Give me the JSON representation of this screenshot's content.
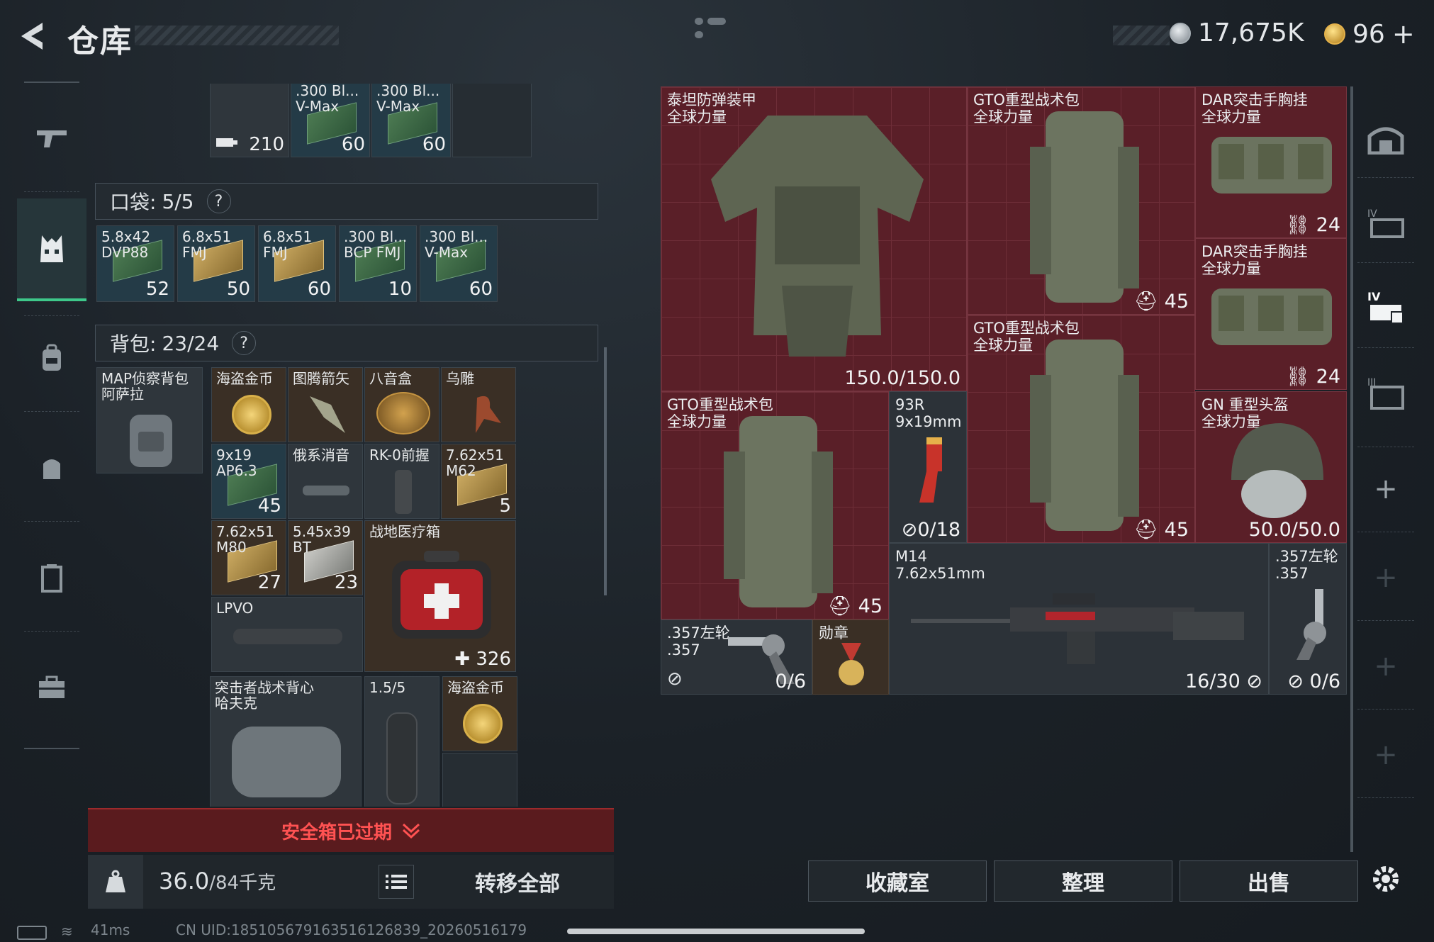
{
  "header": {
    "title": "仓库",
    "currency_main": "17,675K",
    "currency_gold": "96",
    "add_symbol": "+"
  },
  "left": {
    "top_row": [
      {
        "label": "",
        "count": "210",
        "style": "gray"
      },
      {
        "label": ".300 Bl...\nV-Max",
        "count": "60",
        "style": "blue"
      },
      {
        "label": ".300 Bl...\nV-Max",
        "count": "60",
        "style": "blue"
      }
    ],
    "pocket": {
      "label": "口袋:",
      "value": "5/5",
      "help": "?"
    },
    "pocket_items": [
      {
        "label": "5.8x42\nDVP88",
        "count": "52"
      },
      {
        "label": "6.8x51\nFMJ",
        "count": "50"
      },
      {
        "label": "6.8x51\nFMJ",
        "count": "60"
      },
      {
        "label": ".300 Bl...\nBCP FMJ",
        "count": "10"
      },
      {
        "label": ".300 Bl...\nV-Max",
        "count": "60"
      }
    ],
    "backpack": {
      "label": "背包:",
      "value": "23/24",
      "help": "?"
    },
    "backpack_items": {
      "map_pack": "MAP侦察背包\n阿萨拉",
      "pirate_coin": "海盗金币",
      "totem_arrow": "图腾箭矢",
      "octave_box": "八音盒",
      "bird_carving": "乌雕",
      "ap63": {
        "label": "9x19\nAP6.3",
        "count": "45"
      },
      "ru_suppressor": "俄系消音",
      "rk0_grip": "RK-0前握",
      "m62": {
        "label": "7.62x51\nM62",
        "count": "5"
      },
      "m80": {
        "label": "7.62x51\nM80",
        "count": "27"
      },
      "bt": {
        "label": "5.45x39\nBT",
        "count": "23"
      },
      "medkit": {
        "label": "战地医疗箱",
        "count": "326"
      },
      "lpvo": "LPVO",
      "assault_vest": "突击者战术背心\n哈夫克",
      "scope": "1.5/5",
      "pirate_coin_2": "海盗金币"
    },
    "safe_box_expired": "安全箱已过期",
    "weight_value": "36.0",
    "weight_max": "/84千克",
    "transfer_all": "转移全部"
  },
  "right": {
    "items": [
      {
        "id": "titan",
        "label": "泰坦防弹装甲\n全球力量",
        "count": "150.0/150.0"
      },
      {
        "id": "gto1",
        "label": "GTO重型战术包\n全球力量",
        "count": "45"
      },
      {
        "id": "dar1",
        "label": "DAR突击手胸挂\n全球力量",
        "count": "24"
      },
      {
        "id": "dar2",
        "label": "DAR突击手胸挂\n全球力量",
        "count": "24"
      },
      {
        "id": "gto2",
        "label": "GTO重型战术包\n全球力量",
        "count": "45"
      },
      {
        "id": "gto3",
        "label": "GTO重型战术包\n全球力量",
        "count": "45"
      },
      {
        "id": "r93",
        "label": "93R\n9x19mm",
        "count": "0/18"
      },
      {
        "id": "gn",
        "label": "GN 重型头盔\n全球力量",
        "count": "50.0/50.0"
      },
      {
        "id": "m14",
        "label": "M14\n7.62x51mm",
        "count": "16/30",
        "count2": "0/6"
      },
      {
        "id": "rev1",
        "label": ".357左轮\n.357",
        "count": "0/6"
      },
      {
        "id": "medal",
        "label": "勋章",
        "count": ""
      },
      {
        "id": "rev2",
        "label": ".357左轮\n.357",
        "count": ""
      }
    ],
    "buttons": {
      "collection": "收藏室",
      "sort": "整理",
      "sell": "出售"
    }
  },
  "footer": {
    "ping": "41ms",
    "uid": "CN UID:185105679163516126839_20260516179"
  },
  "colors": {
    "accent_green": "#3ec88a",
    "item_red": "#5a1f28",
    "expired_red": "#ff5252"
  }
}
